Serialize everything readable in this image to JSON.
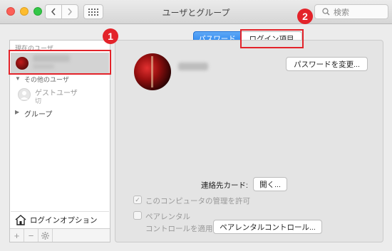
{
  "window": {
    "title": "ユーザとグループ"
  },
  "search": {
    "placeholder": "検索"
  },
  "sidebar": {
    "current_user_header": "現在のユーザ",
    "other_users_header": "その他のユーザ",
    "guest": {
      "name": "ゲストユーザ",
      "status": "切"
    },
    "group_label": "グループ",
    "login_options": "ログインオプション"
  },
  "tabs": {
    "password": "パスワード",
    "login_items": "ログイン項目"
  },
  "panel": {
    "change_password": "パスワードを変更...",
    "contact_card_label": "連絡先カード:",
    "open_button": "開く...",
    "allow_admin": "このコンピュータの管理を許可",
    "parental_line1": "ペアレンタル",
    "parental_line2": "コントロールを適用",
    "parental_button": "ペアレンタルコントロール..."
  },
  "annotations": {
    "badge1": "1",
    "badge2": "2"
  },
  "colors": {
    "accent_blue": "#1d7ff0",
    "callout_red": "#e3232a"
  }
}
